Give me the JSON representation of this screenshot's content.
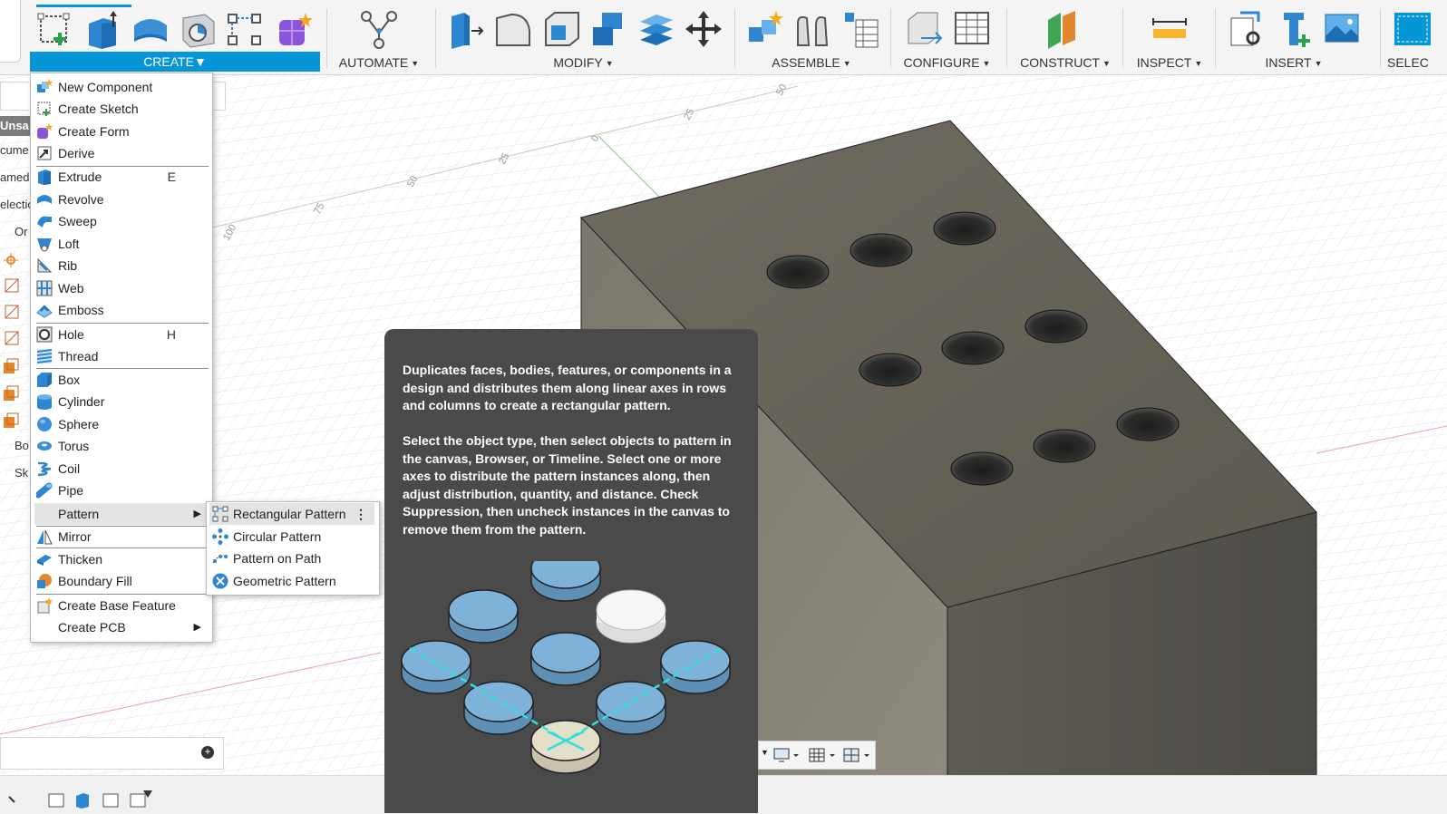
{
  "toolbar": {
    "groups": [
      {
        "label": "CREATE",
        "active": true
      },
      {
        "label": "AUTOMATE"
      },
      {
        "label": "MODIFY"
      },
      {
        "label": "ASSEMBLE"
      },
      {
        "label": "CONFIGURE"
      },
      {
        "label": "CONSTRUCT"
      },
      {
        "label": "INSPECT"
      },
      {
        "label": "INSERT"
      },
      {
        "label": "SELEC"
      }
    ],
    "accent_color": "#0696d7"
  },
  "browser_panel": {
    "items": [
      "Unsa",
      "cume",
      "amed",
      "electio",
      "Or",
      "Bo",
      "Sk"
    ]
  },
  "canvas": {
    "ruler_labels": [
      "50",
      "25",
      "0",
      "25",
      "50",
      "75",
      "100"
    ]
  },
  "create_menu": {
    "items": [
      {
        "label": "New Component",
        "icon": "new-component-icon"
      },
      {
        "label": "Create Sketch",
        "icon": "create-sketch-icon"
      },
      {
        "label": "Create Form",
        "icon": "create-form-icon"
      },
      {
        "label": "Derive",
        "icon": "derive-icon"
      },
      {
        "label": "Extrude",
        "shortcut": "E",
        "icon": "extrude-icon"
      },
      {
        "label": "Revolve",
        "icon": "revolve-icon"
      },
      {
        "label": "Sweep",
        "icon": "sweep-icon"
      },
      {
        "label": "Loft",
        "icon": "loft-icon"
      },
      {
        "label": "Rib",
        "icon": "rib-icon"
      },
      {
        "label": "Web",
        "icon": "web-icon"
      },
      {
        "label": "Emboss",
        "icon": "emboss-icon"
      },
      {
        "label": "Hole",
        "shortcut": "H",
        "icon": "hole-icon"
      },
      {
        "label": "Thread",
        "icon": "thread-icon"
      },
      {
        "label": "Box",
        "icon": "box-icon"
      },
      {
        "label": "Cylinder",
        "icon": "cylinder-icon"
      },
      {
        "label": "Sphere",
        "icon": "sphere-icon"
      },
      {
        "label": "Torus",
        "icon": "torus-icon"
      },
      {
        "label": "Coil",
        "icon": "coil-icon"
      },
      {
        "label": "Pipe",
        "icon": "pipe-icon"
      },
      {
        "label": "Pattern",
        "has_submenu": true
      },
      {
        "label": "Mirror",
        "icon": "mirror-icon"
      },
      {
        "label": "Thicken",
        "icon": "thicken-icon"
      },
      {
        "label": "Boundary Fill",
        "icon": "boundary-fill-icon"
      },
      {
        "label": "Create Base Feature",
        "icon": "base-feature-icon"
      },
      {
        "label": "Create PCB",
        "has_submenu": true
      }
    ]
  },
  "pattern_submenu": {
    "items": [
      {
        "label": "Rectangular Pattern",
        "icon": "rectangular-pattern-icon"
      },
      {
        "label": "Circular Pattern",
        "icon": "circular-pattern-icon"
      },
      {
        "label": "Pattern on Path",
        "icon": "pattern-on-path-icon"
      },
      {
        "label": "Geometric Pattern",
        "icon": "geometric-pattern-icon"
      }
    ]
  },
  "tooltip": {
    "paragraph1": "Duplicates faces, bodies, features, or components in a design and distributes them along linear axes in rows and columns to create a rectangular pattern.",
    "paragraph2": "Select the object type, then select objects to pattern in the canvas, Browser, or Timeline. Select one or more axes to distribute the pattern instances along, then adjust distribution, quantity, and distance. Check Suppression, then uncheck instances in the canvas to remove them from the pattern."
  }
}
